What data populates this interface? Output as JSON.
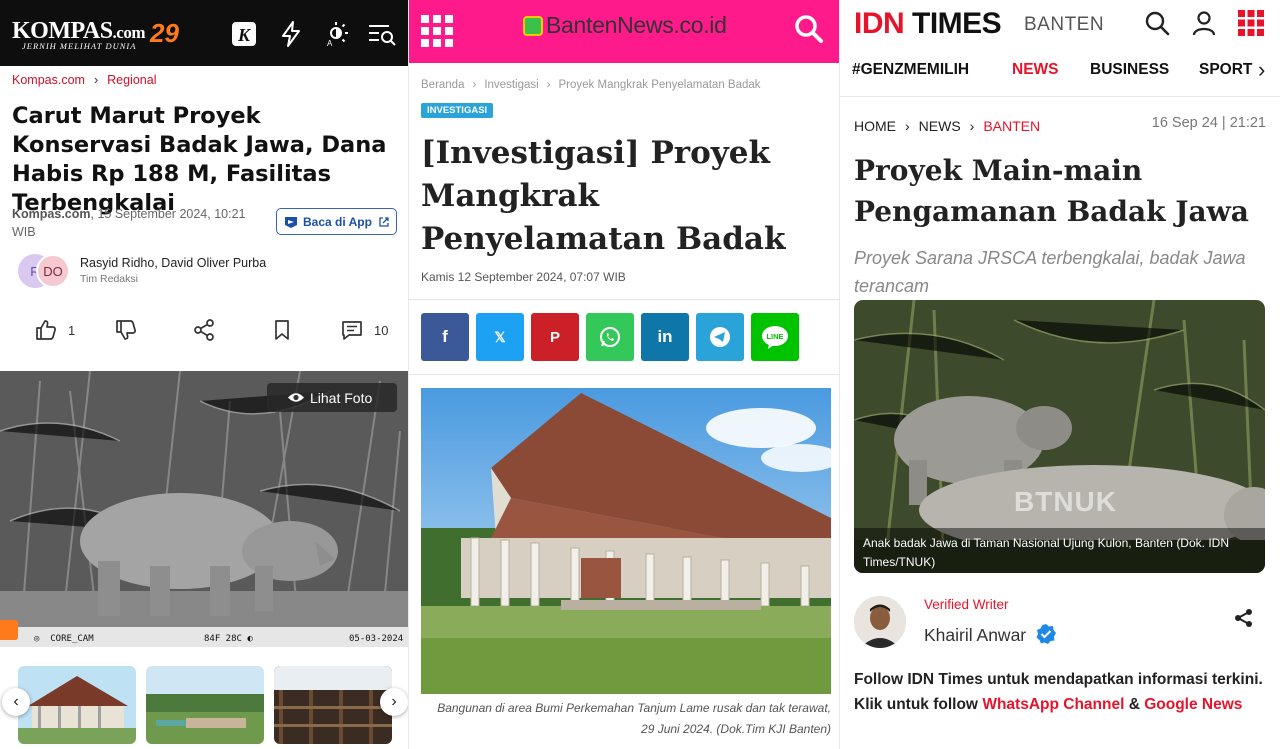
{
  "kompas": {
    "brand": "KOMPAS",
    "brand_domain": ".com",
    "anniversary": "29",
    "tagline": "JERNIH MELIHAT DUNIA",
    "breadcrumb": [
      "Kompas.com",
      "Regional"
    ],
    "title": "Carut Marut Proyek Konservasi Badak Jawa, Dana Habis Rp 188 M, Fasilitas Terbengkalai",
    "source": "Kompas.com",
    "date": ", 15 September 2024, 10:21 WIB",
    "app_button": "Baca di App",
    "avatar_initials": [
      "R",
      "DO"
    ],
    "authors": "Rasyid Ridho, David Oliver Purba",
    "team": "Tim Redaksi",
    "like_count": "1",
    "comment_count": "10",
    "photo_button": "Lihat Foto",
    "camera_stamp": {
      "cam": "CORE_CAM",
      "temp": "84F 28C",
      "date": "05-03-2024"
    },
    "colors": {
      "header": "#0e0e0e",
      "accent": "#c8122a",
      "anniversary": "#ff7a1a",
      "app_button": "#1c4fa8"
    }
  },
  "banten": {
    "logo_text": "BantenNews.co.id",
    "breadcrumb": [
      "Beranda",
      "Investigasi",
      "Proyek Mangkrak Penyelamatan Badak"
    ],
    "badge": "INVESTIGASI",
    "title": "[Investigasi] Proyek Mangkrak Penyelamatan Badak",
    "date": "Kamis 12 September 2024, 07:07 WIB",
    "share_buttons": [
      {
        "name": "facebook",
        "glyph": "f",
        "color": "#3b5998"
      },
      {
        "name": "x",
        "glyph": "𝕏",
        "color": "#1da1f2"
      },
      {
        "name": "pinterest",
        "glyph": "P",
        "color": "#cb2027"
      },
      {
        "name": "whatsapp",
        "glyph": "☏",
        "color": "#34c759"
      },
      {
        "name": "linkedin",
        "glyph": "in",
        "color": "#0e76a8"
      },
      {
        "name": "telegram",
        "glyph": "➤",
        "color": "#2aa3d9"
      },
      {
        "name": "line",
        "glyph": "LINE",
        "color": "#00c300"
      }
    ],
    "caption": "Bangunan di area Bumi Perkemahan Tanjum Lame rusak dan tak terawat, 29 Juni 2024. (Dok.Tim KJI Banten)",
    "colors": {
      "header": "#ff1a8c",
      "badge": "#2aa3d9"
    }
  },
  "idn": {
    "logo_idn": "IDN",
    "logo_times": "TIMES",
    "region": "BANTEN",
    "nav": [
      "#GENZMEMILIH",
      "NEWS",
      "BUSINESS",
      "SPORT"
    ],
    "breadcrumb": [
      "HOME",
      "NEWS",
      "BANTEN"
    ],
    "date": "16 Sep 24 | 21:21",
    "title": "Proyek Main-main Pengamanan Badak Jawa",
    "subtitle": "Proyek Sarana JRSCA terbengkalai, badak Jawa terancam",
    "photo_watermark": "BTNUK",
    "photo_caption": "Anak badak Jawa di Taman Nasional Ujung Kulon, Banten (Dok. IDN Times/TNUK)",
    "verified_label": "Verified Writer",
    "writer_name": "Khairil Anwar",
    "follow_text_1": "Follow IDN Times untuk mendapatkan informasi terkini. Klik untuk follow ",
    "follow_link_1": "WhatsApp Channel",
    "follow_and": " & ",
    "follow_link_2": "Google News",
    "colors": {
      "accent": "#e8132b",
      "verified": "#1e88e5"
    }
  }
}
